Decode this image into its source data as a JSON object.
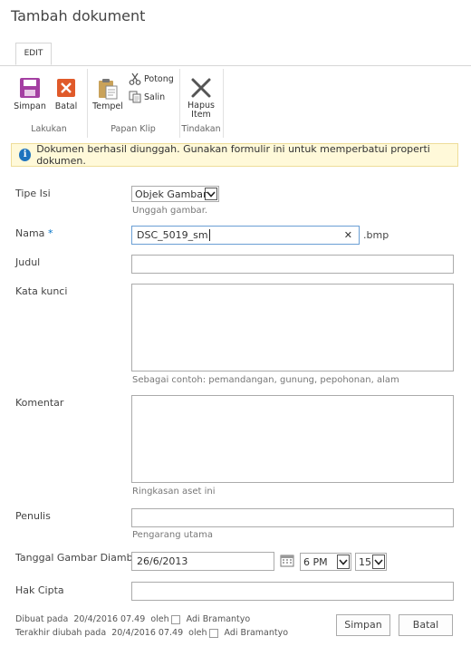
{
  "page_title": "Tambah dokument",
  "ribbon": {
    "tab_edit": "EDIT",
    "groups": {
      "lakukan": {
        "label": "Lakukan",
        "simpan": "Simpan",
        "batal": "Batal"
      },
      "papan_klip": {
        "label": "Papan Klip",
        "tempel": "Tempel",
        "potong": "Potong",
        "salin": "Salin"
      },
      "tindakan": {
        "label": "Tindakan",
        "hapus_line1": "Hapus",
        "hapus_line2": "Item"
      }
    }
  },
  "info_message": "Dokumen berhasil diunggah. Gunakan formulir ini untuk memperbatui properti dokumen.",
  "form": {
    "tipe_isi": {
      "label": "Tipe Isi",
      "value": "Objek Gambar",
      "hint": "Unggah gambar."
    },
    "nama": {
      "label": "Nama",
      "required_mark": "*",
      "value": "DSC_5019_sm",
      "extension": ".bmp",
      "clear_glyph": "✕"
    },
    "judul": {
      "label": "Judul",
      "value": ""
    },
    "kata_kunci": {
      "label": "Kata kunci",
      "value": "",
      "hint": "Sebagai contoh: pemandangan, gunung, pepohonan, alam"
    },
    "komentar": {
      "label": "Komentar",
      "value": "",
      "hint": "Ringkasan aset ini"
    },
    "penulis": {
      "label": "Penulis",
      "value": "",
      "hint": "Pengarang utama"
    },
    "tanggal": {
      "label": "Tanggal Gambar Diambil",
      "date": "26/6/2013",
      "hour": "6 PM",
      "minute": "15"
    },
    "hak_cipta": {
      "label": "Hak Cipta",
      "value": ""
    }
  },
  "footer": {
    "created_label": "Dibuat pada",
    "created_date": "20/4/2016 07.49",
    "created_by_label": "oleh",
    "created_by": "Adi Bramantyo",
    "modified_label": "Terakhir diubah pada",
    "modified_date": "20/4/2016 07.49",
    "modified_by_label": "oleh",
    "modified_by": "Adi Bramantyo",
    "save_button": "Simpan",
    "cancel_button": "Batal"
  },
  "colors": {
    "accent": "#0072c6",
    "save_icon": "#a43fa2",
    "cancel_icon": "#e05a2a",
    "info_bg": "#fff9d9"
  }
}
